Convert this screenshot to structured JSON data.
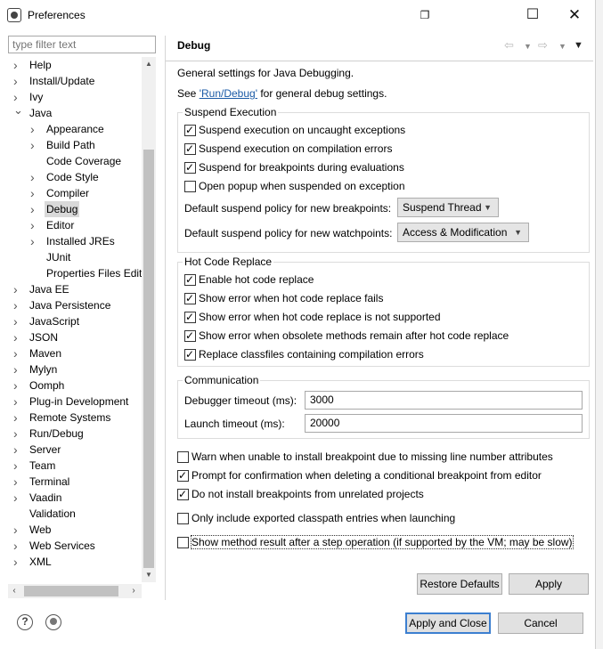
{
  "window": {
    "title": "Preferences"
  },
  "filter": {
    "placeholder": "type filter text"
  },
  "tree": [
    {
      "label": "Help",
      "level": 0,
      "expander": "collapsed"
    },
    {
      "label": "Install/Update",
      "level": 0,
      "expander": "collapsed"
    },
    {
      "label": "Ivy",
      "level": 0,
      "expander": "collapsed"
    },
    {
      "label": "Java",
      "level": 0,
      "expander": "expanded"
    },
    {
      "label": "Appearance",
      "level": 1,
      "expander": "collapsed"
    },
    {
      "label": "Build Path",
      "level": 1,
      "expander": "collapsed"
    },
    {
      "label": "Code Coverage",
      "level": 1,
      "expander": "none"
    },
    {
      "label": "Code Style",
      "level": 1,
      "expander": "collapsed"
    },
    {
      "label": "Compiler",
      "level": 1,
      "expander": "collapsed"
    },
    {
      "label": "Debug",
      "level": 1,
      "expander": "collapsed",
      "selected": true
    },
    {
      "label": "Editor",
      "level": 1,
      "expander": "collapsed"
    },
    {
      "label": "Installed JREs",
      "level": 1,
      "expander": "collapsed"
    },
    {
      "label": "JUnit",
      "level": 1,
      "expander": "none"
    },
    {
      "label": "Properties Files Edito",
      "level": 1,
      "expander": "none"
    },
    {
      "label": "Java EE",
      "level": 0,
      "expander": "collapsed"
    },
    {
      "label": "Java Persistence",
      "level": 0,
      "expander": "collapsed"
    },
    {
      "label": "JavaScript",
      "level": 0,
      "expander": "collapsed"
    },
    {
      "label": "JSON",
      "level": 0,
      "expander": "collapsed"
    },
    {
      "label": "Maven",
      "level": 0,
      "expander": "collapsed"
    },
    {
      "label": "Mylyn",
      "level": 0,
      "expander": "collapsed"
    },
    {
      "label": "Oomph",
      "level": 0,
      "expander": "collapsed"
    },
    {
      "label": "Plug-in Development",
      "level": 0,
      "expander": "collapsed"
    },
    {
      "label": "Remote Systems",
      "level": 0,
      "expander": "collapsed"
    },
    {
      "label": "Run/Debug",
      "level": 0,
      "expander": "collapsed"
    },
    {
      "label": "Server",
      "level": 0,
      "expander": "collapsed"
    },
    {
      "label": "Team",
      "level": 0,
      "expander": "collapsed"
    },
    {
      "label": "Terminal",
      "level": 0,
      "expander": "collapsed"
    },
    {
      "label": "Vaadin",
      "level": 0,
      "expander": "collapsed"
    },
    {
      "label": "Validation",
      "level": 0,
      "expander": "none"
    },
    {
      "label": "Web",
      "level": 0,
      "expander": "collapsed"
    },
    {
      "label": "Web Services",
      "level": 0,
      "expander": "collapsed"
    },
    {
      "label": "XML",
      "level": 0,
      "expander": "collapsed"
    }
  ],
  "page": {
    "title": "Debug",
    "description": "General settings for Java Debugging.",
    "see_prefix": "See ",
    "see_link": "'Run/Debug'",
    "see_suffix": " for general debug settings.",
    "suspend": {
      "title": "Suspend Execution",
      "options": [
        {
          "label": "Suspend execution on uncaught exceptions",
          "checked": true
        },
        {
          "label": "Suspend execution on compilation errors",
          "checked": true
        },
        {
          "label": "Suspend for breakpoints during evaluations",
          "checked": true
        },
        {
          "label": "Open popup when suspended on exception",
          "checked": false
        }
      ],
      "bp_policy_label": "Default suspend policy for new breakpoints:",
      "bp_policy_value": "Suspend Thread",
      "wp_policy_label": "Default suspend policy for new watchpoints:",
      "wp_policy_value": "Access & Modification"
    },
    "hcr": {
      "title": "Hot Code Replace",
      "options": [
        {
          "label": "Enable hot code replace",
          "checked": true
        },
        {
          "label": "Show error when hot code replace fails",
          "checked": true
        },
        {
          "label": "Show error when hot code replace is not supported",
          "checked": true
        },
        {
          "label": "Show error when obsolete methods remain after hot code replace",
          "checked": true
        },
        {
          "label": "Replace classfiles containing compilation errors",
          "checked": true
        }
      ]
    },
    "comm": {
      "title": "Communication",
      "debugger_timeout_label": "Debugger timeout (ms):",
      "debugger_timeout_value": "3000",
      "launch_timeout_label": "Launch timeout (ms):",
      "launch_timeout_value": "20000"
    },
    "misc": [
      {
        "label": "Warn when unable to install breakpoint due to missing line number attributes",
        "checked": false
      },
      {
        "label": "Prompt for confirmation when deleting a conditional breakpoint from editor",
        "checked": true
      },
      {
        "label": "Do not install breakpoints from unrelated projects",
        "checked": true
      },
      {
        "label": "Only include exported classpath entries when launching",
        "checked": false
      },
      {
        "label": "Show method result after a step operation (if supported by the VM; may be slow)",
        "checked": false
      }
    ],
    "restore_defaults": "Restore Defaults",
    "apply": "Apply"
  },
  "footer": {
    "apply_close": "Apply and Close",
    "cancel": "Cancel",
    "help_icon_glyph": "?"
  },
  "colors": {
    "link": "#1a5aa6",
    "selection": "#d9d9d9",
    "default_button_border": "#3c7fd0"
  }
}
